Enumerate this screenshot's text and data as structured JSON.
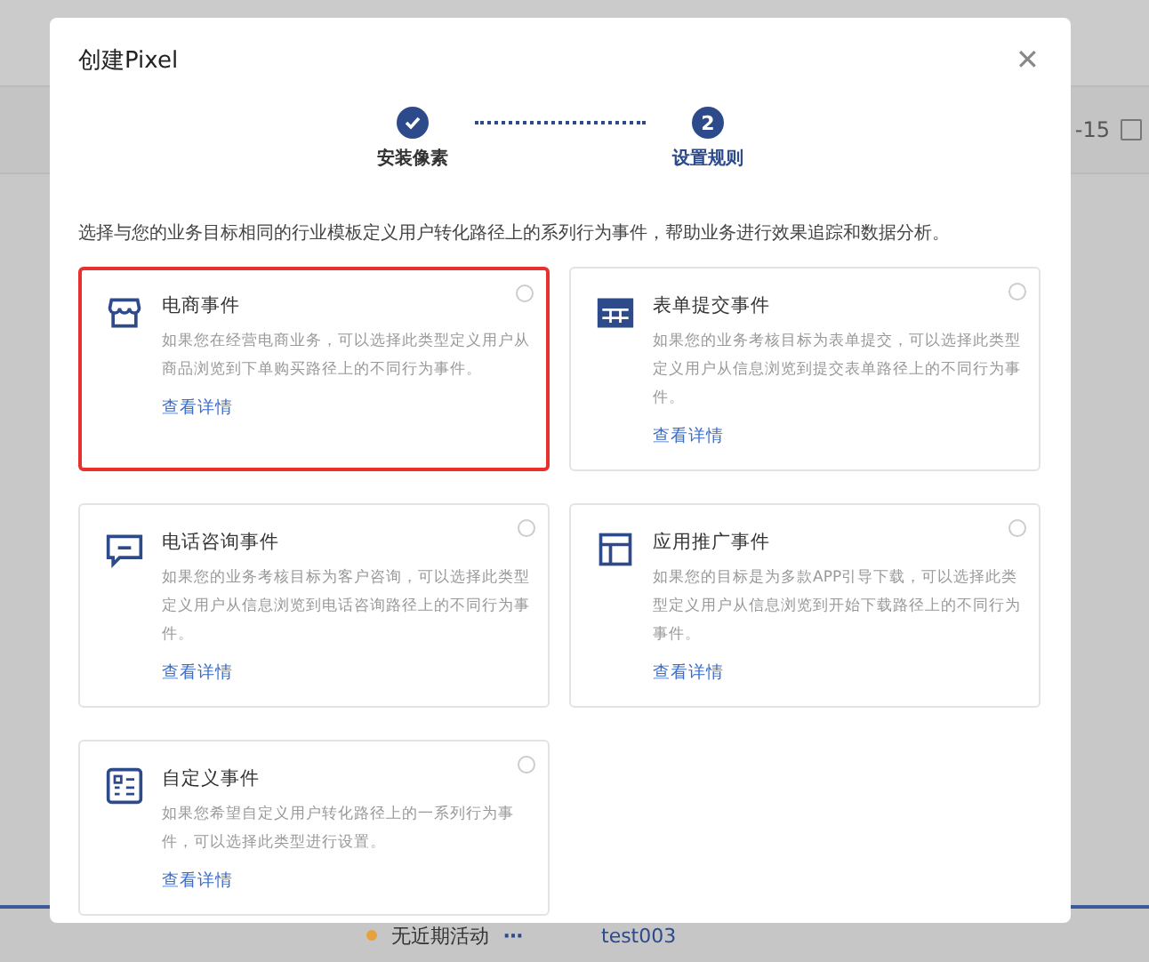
{
  "background": {
    "date_text": "-15",
    "status": {
      "text": "无近期活动",
      "color": "#e6a23c"
    },
    "more": "⋯",
    "link": "test003"
  },
  "dialog": {
    "title": "创建Pixel",
    "close": "✕",
    "steps": [
      {
        "label": "安装像素",
        "done": true,
        "selected": false
      },
      {
        "label": "设置规则",
        "number": "2",
        "done": false,
        "selected": true
      }
    ],
    "description": "选择与您的业务目标相同的行业模板定义用户转化路径上的系列行为事件，帮助业务进行效果追踪和数据分析。",
    "cards": [
      {
        "kind": "shop",
        "title": "电商事件",
        "text": "如果您在经营电商业务，可以选择此类型定义用户从商品浏览到下单购买路径上的不同行为事件。",
        "link": "查看详情",
        "selected": false,
        "highlighted": true
      },
      {
        "kind": "table",
        "title": "表单提交事件",
        "text": "如果您的业务考核目标为表单提交，可以选择此类型定义用户从信息浏览到提交表单路径上的不同行为事件。",
        "link": "查看详情",
        "selected": false,
        "highlighted": false
      },
      {
        "kind": "chat",
        "title": "电话咨询事件",
        "text": "如果您的业务考核目标为客户咨询，可以选择此类型定义用户从信息浏览到电话咨询路径上的不同行为事件。",
        "link": "查看详情",
        "selected": false,
        "highlighted": false
      },
      {
        "kind": "layout",
        "title": "应用推广事件",
        "text": "如果您的目标是为多款APP引导下载，可以选择此类型定义用户从信息浏览到开始下载路径上的不同行为事件。",
        "link": "查看详情",
        "selected": false,
        "highlighted": false
      },
      {
        "kind": "list",
        "title": "自定义事件",
        "text": "如果您希望自定义用户转化路径上的一系列行为事件，可以选择此类型进行设置。",
        "link": "查看详情",
        "selected": false,
        "highlighted": false
      }
    ]
  }
}
